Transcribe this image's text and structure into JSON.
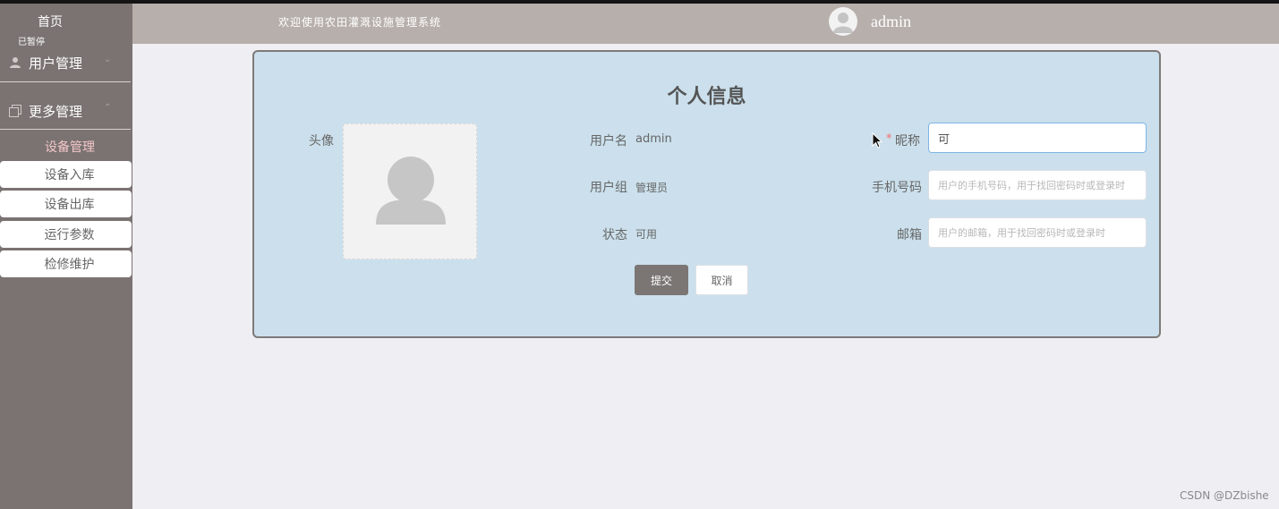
{
  "sidebar": {
    "home_label": "首页",
    "paused_text": "已暂停",
    "groups": [
      {
        "icon": "user-icon",
        "label": "用户管理",
        "expanded": false
      },
      {
        "icon": "copy-icon",
        "label": "更多管理",
        "expanded": true
      }
    ],
    "submenu_title": "设备管理",
    "submenu_items": [
      {
        "label": "设备入库"
      },
      {
        "label": "设备出库"
      },
      {
        "label": "运行参数"
      },
      {
        "label": "检修维护"
      }
    ]
  },
  "header": {
    "welcome_text": "欢迎使用农田灌溉设施管理系统",
    "avatar_icon": "user-avatar-icon",
    "username": "admin"
  },
  "profile": {
    "title": "个人信息",
    "avatar_label": "头像",
    "username_label": "用户名",
    "username_value": "admin",
    "group_label": "用户组",
    "group_value": "管理员",
    "status_label": "状态",
    "status_value": "可用",
    "required_mark": "*",
    "nickname_label": "昵称",
    "nickname_value": "可",
    "phone_label": "手机号码",
    "phone_placeholder": "用户的手机号码，用于找回密码时或登录时",
    "email_label": "邮箱",
    "email_placeholder": "用户的邮箱，用于找回密码时或登录时",
    "submit_label": "提交",
    "cancel_label": "取消"
  },
  "watermark": "CSDN @DZbishe",
  "colors": {
    "sidebar_bg": "#7a7372",
    "header_bg": "#b7afab",
    "card_bg": "#cbe0ec",
    "submit_bg": "#7b7574",
    "submenu_title": "#f4c6c8",
    "required": "#f56c6c"
  }
}
